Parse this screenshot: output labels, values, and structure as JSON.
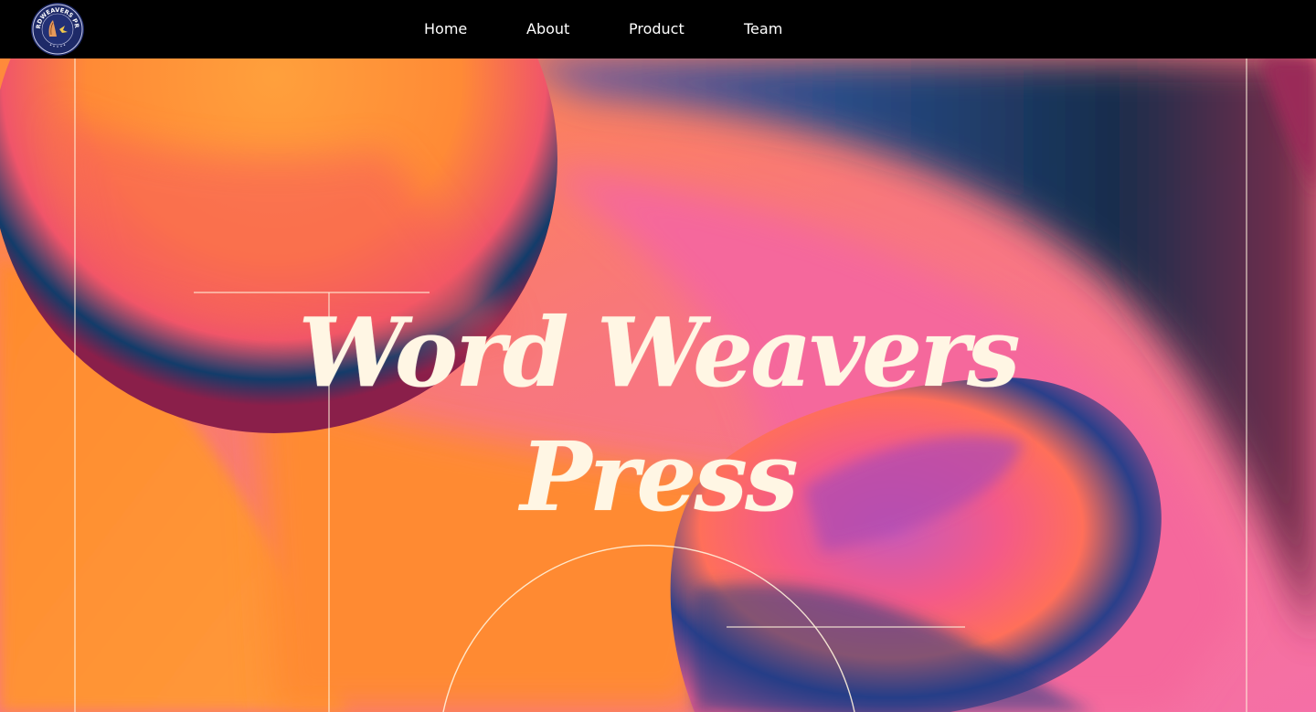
{
  "navbar": {
    "logo_text": "WORDWEAVERS PRESS",
    "items": [
      {
        "label": "Home"
      },
      {
        "label": "About"
      },
      {
        "label": "Product"
      },
      {
        "label": "Team"
      }
    ]
  },
  "hero": {
    "title_line1": "Word Weavers",
    "title_line2": "Press"
  },
  "colors": {
    "navbar_bg": "#000000",
    "title": "#fff6e4",
    "orange": "#ff9535",
    "pink": "#f56fa0",
    "navy": "#16305f",
    "line": "#fff2dc"
  },
  "icons": [
    "wordweavers-press-logo"
  ]
}
